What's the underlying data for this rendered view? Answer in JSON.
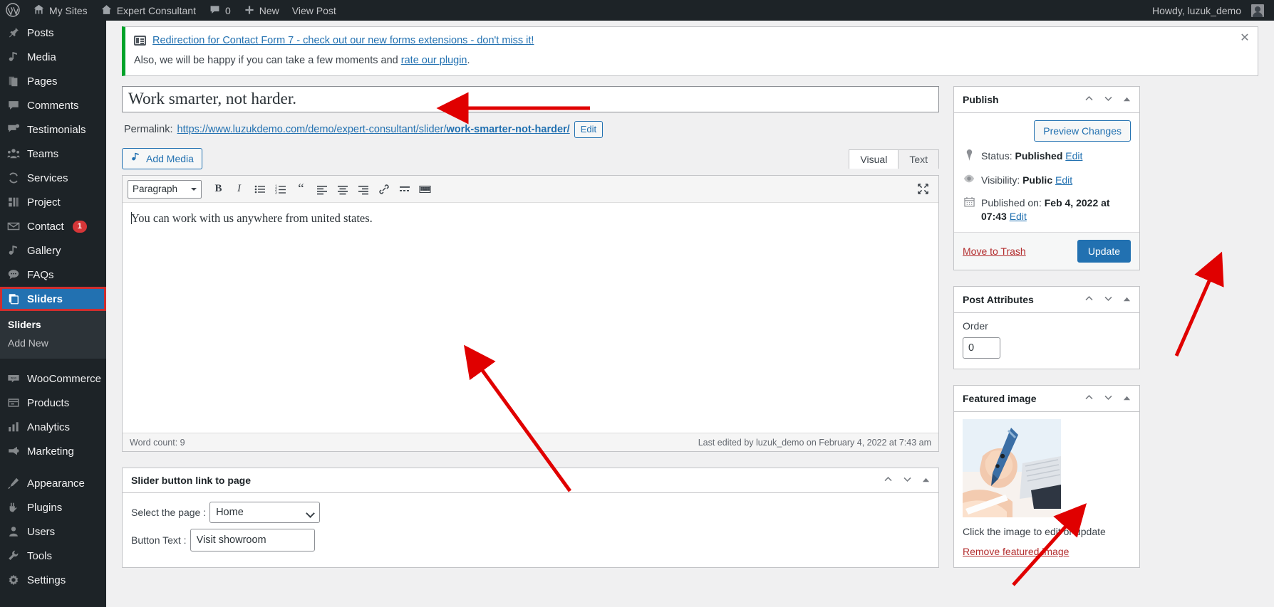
{
  "adminbar": {
    "items": [
      {
        "label": "",
        "icon": "wordpress-logo-icon"
      },
      {
        "label": "My Sites",
        "icon": "sites-icon"
      },
      {
        "label": "Expert Consultant",
        "icon": "home-icon"
      },
      {
        "label": "0",
        "icon": "comment-bubble-icon"
      },
      {
        "label": "New",
        "icon": "plus-icon"
      },
      {
        "label": "View Post",
        "icon": ""
      }
    ],
    "my_sites": "My Sites",
    "site_name": "Expert Consultant",
    "comment_count": "0",
    "new_label": "New",
    "view_post": "View Post",
    "howdy": "Howdy, luzuk_demo"
  },
  "sidebar": {
    "items": [
      {
        "label": "Posts",
        "icon": "pin-icon",
        "current": false
      },
      {
        "label": "Media",
        "icon": "media-icon",
        "current": false
      },
      {
        "label": "Pages",
        "icon": "pages-icon",
        "current": false
      },
      {
        "label": "Comments",
        "icon": "comments-icon",
        "current": false
      },
      {
        "label": "Testimonials",
        "icon": "testimonials-icon",
        "current": false
      },
      {
        "label": "Teams",
        "icon": "teams-icon",
        "current": false
      },
      {
        "label": "Services",
        "icon": "services-icon",
        "current": false
      },
      {
        "label": "Project",
        "icon": "project-icon",
        "current": false
      },
      {
        "label": "Contact",
        "icon": "mail-icon",
        "current": false,
        "badge": "1"
      },
      {
        "label": "Gallery",
        "icon": "gallery-icon",
        "current": false
      },
      {
        "label": "FAQs",
        "icon": "faq-icon",
        "current": false
      },
      {
        "label": "Sliders",
        "icon": "sliders-icon",
        "current": true
      }
    ],
    "submenu": [
      {
        "label": "Sliders",
        "current": true
      },
      {
        "label": "Add New",
        "current": false
      }
    ],
    "items2": [
      {
        "label": "WooCommerce",
        "icon": "woocommerce-icon"
      },
      {
        "label": "Products",
        "icon": "products-icon"
      },
      {
        "label": "Analytics",
        "icon": "analytics-icon"
      },
      {
        "label": "Marketing",
        "icon": "marketing-icon"
      }
    ],
    "items3": [
      {
        "label": "Appearance",
        "icon": "appearance-icon"
      },
      {
        "label": "Plugins",
        "icon": "plugins-icon"
      },
      {
        "label": "Users",
        "icon": "users-icon"
      },
      {
        "label": "Tools",
        "icon": "tools-icon"
      },
      {
        "label": "Settings",
        "icon": "settings-icon"
      }
    ]
  },
  "notice": {
    "link_text": "Redirection for Contact Form 7 - check out our new forms extensions - don't miss it!",
    "body_prefix": "Also, we will be happy if you can take a few moments and ",
    "body_link": "rate our plugin",
    "body_suffix": ".",
    "accent_color": "#00a32a"
  },
  "post": {
    "title_value": "Work smarter, not harder.",
    "permalink_label": "Permalink:",
    "permalink_base": "https://www.luzukdemo.com/demo/expert-consultant/slider/",
    "permalink_slug": "work-smarter-not-harder/",
    "permalink_edit": "Edit",
    "content": "You can work with us anywhere from united states."
  },
  "editor": {
    "add_media": "Add Media",
    "tab_visual": "Visual",
    "tab_text": "Text",
    "format_select": "Paragraph",
    "toolbar_buttons": [
      {
        "name": "bold-icon",
        "label": "B"
      },
      {
        "name": "italic-icon",
        "label": "I"
      },
      {
        "name": "bulleted-list-icon",
        "label": ""
      },
      {
        "name": "numbered-list-icon",
        "label": ""
      },
      {
        "name": "blockquote-icon",
        "label": "“"
      },
      {
        "name": "align-left-icon",
        "label": ""
      },
      {
        "name": "align-center-icon",
        "label": ""
      },
      {
        "name": "align-right-icon",
        "label": ""
      },
      {
        "name": "insert-link-icon",
        "label": ""
      },
      {
        "name": "read-more-icon",
        "label": ""
      },
      {
        "name": "keyboard-toolbar-toggle-icon",
        "label": ""
      }
    ],
    "fullscreen_icon": "distraction-free-icon",
    "word_count": "Word count: 9",
    "last_edited": "Last edited by luzuk_demo on February 4, 2022 at 7:43 am"
  },
  "slider_metabox": {
    "title": "Slider button link to page",
    "select_label": "Select the page :",
    "select_value": "Home",
    "button_text_label": "Button Text :",
    "button_text_value": "Visit showroom"
  },
  "publish": {
    "title": "Publish",
    "preview_changes": "Preview Changes",
    "status_label": "Status:",
    "status_value": "Published",
    "status_edit": "Edit",
    "visibility_label": "Visibility:",
    "visibility_value": "Public",
    "visibility_edit": "Edit",
    "published_label": "Published on:",
    "published_value": "Feb 4, 2022 at 07:43",
    "published_edit": "Edit",
    "move_to_trash": "Move to Trash",
    "update": "Update",
    "primary_color": "#2271b1"
  },
  "post_attributes": {
    "title": "Post Attributes",
    "order_label": "Order",
    "order_value": "0"
  },
  "featured_image": {
    "title": "Featured image",
    "caption": "Click the image to edit or update",
    "remove": "Remove featured image"
  },
  "annotations": {
    "arrow_color": "#e00000",
    "highlight_color": "#cf2e2e"
  }
}
